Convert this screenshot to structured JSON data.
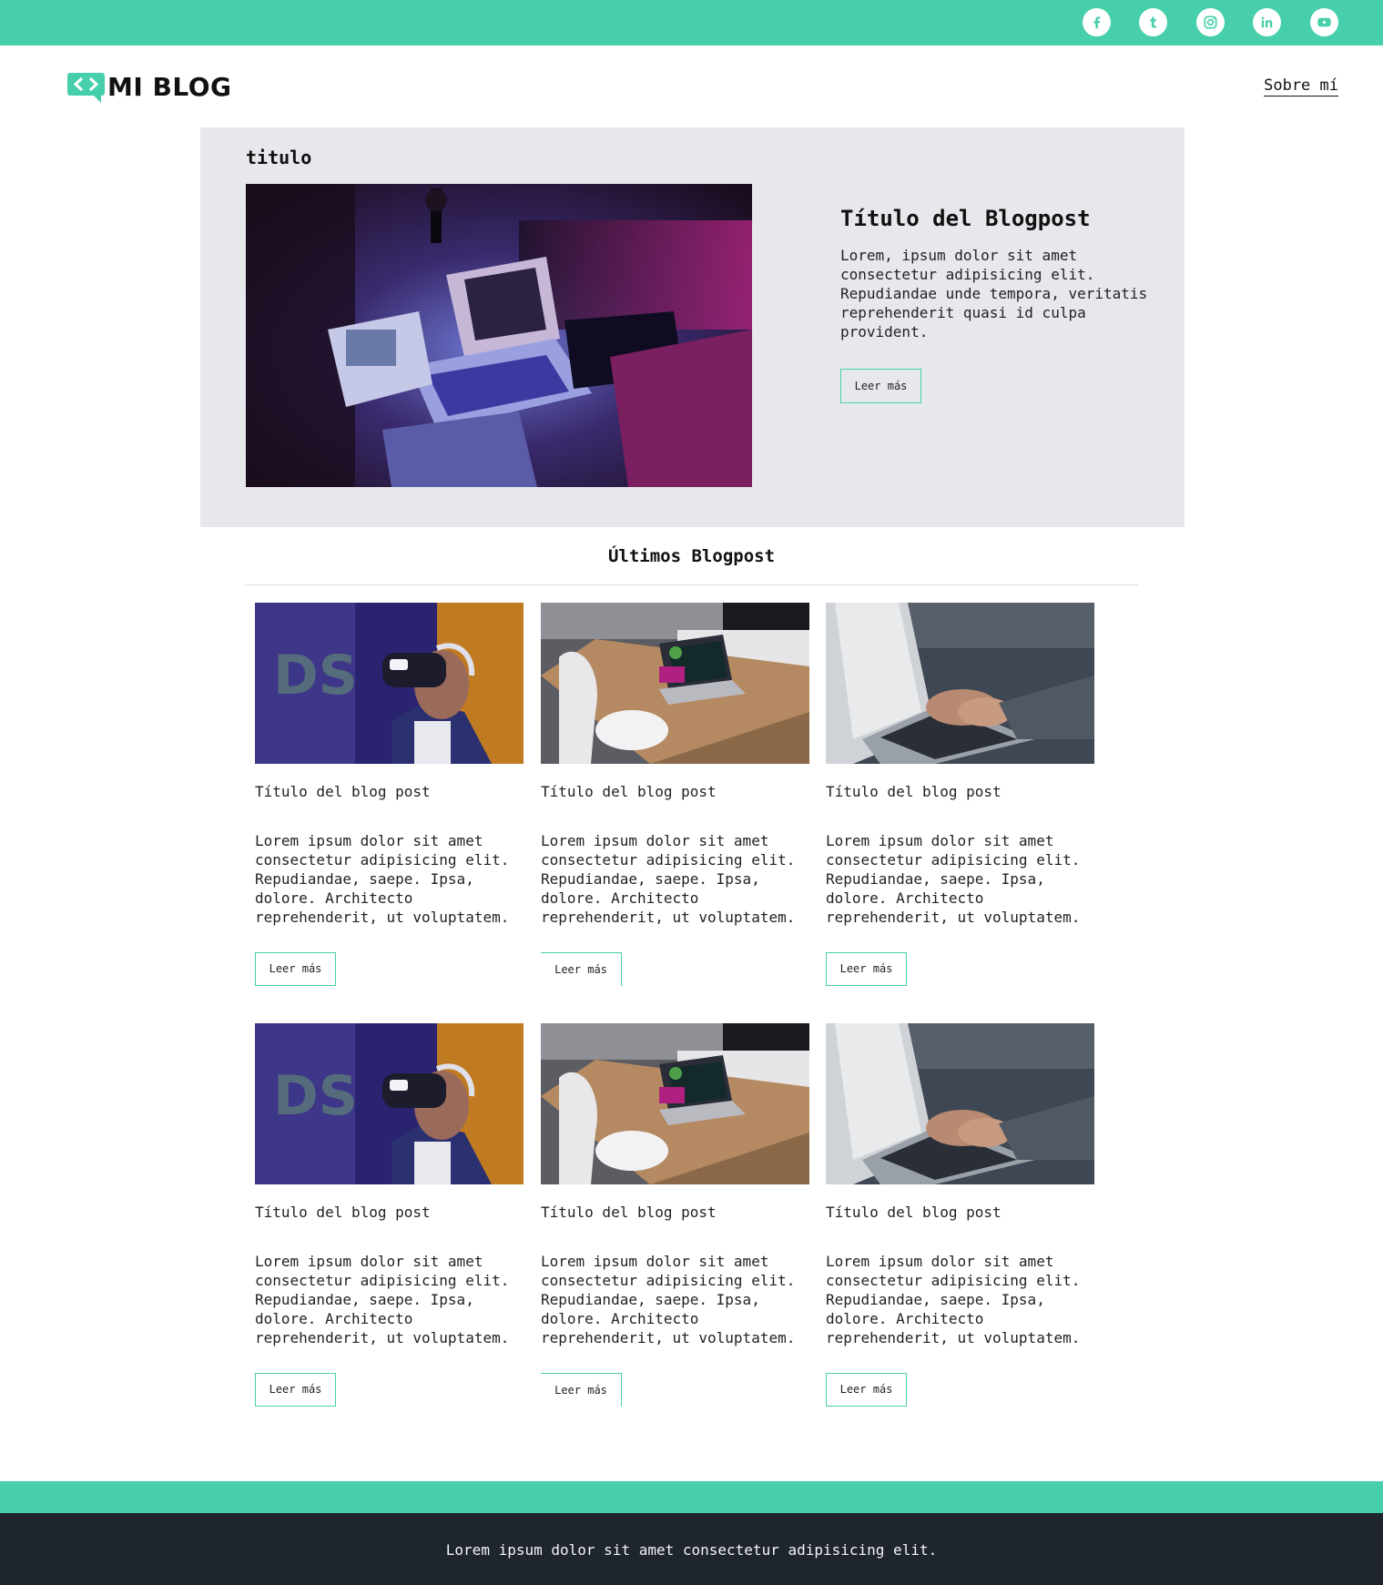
{
  "header": {
    "social": [
      {
        "name": "facebook-icon"
      },
      {
        "name": "tumblr-icon"
      },
      {
        "name": "instagram-icon"
      },
      {
        "name": "linkedin-icon"
      },
      {
        "name": "youtube-icon"
      }
    ],
    "logo_text": "MI BLOG",
    "about_link": "Sobre mí"
  },
  "hero": {
    "label": "titulo",
    "title": "Título del Blogpost",
    "description": "Lorem, ipsum dolor sit amet consectetur adipisicing elit. Repudiandae unde tempora, veritatis reprehenderit quasi id culpa provident.",
    "button": "Leer más"
  },
  "latest": {
    "title": "Últimos Blogpost",
    "posts": [
      {
        "title": "Título del blog post",
        "description": "Lorem ipsum dolor sit amet consectetur adipisicing elit. Repudiandae, saepe. Ipsa, dolore. Architecto reprehenderit, ut voluptatem.",
        "button": "Leer más"
      },
      {
        "title": "Título del blog post",
        "description": "Lorem ipsum dolor sit amet consectetur adipisicing elit. Repudiandae, saepe. Ipsa, dolore. Architecto reprehenderit, ut voluptatem.",
        "button": "Leer más"
      },
      {
        "title": "Título del blog post",
        "description": "Lorem ipsum dolor sit amet consectetur adipisicing elit. Repudiandae, saepe. Ipsa, dolore. Architecto reprehenderit, ut voluptatem.",
        "button": "Leer más"
      },
      {
        "title": "Título del blog post",
        "description": "Lorem ipsum dolor sit amet consectetur adipisicing elit. Repudiandae, saepe. Ipsa, dolore. Architecto reprehenderit, ut voluptatem.",
        "button": "Leer más"
      },
      {
        "title": "Título del blog post",
        "description": "Lorem ipsum dolor sit amet consectetur adipisicing elit. Repudiandae, saepe. Ipsa, dolore. Architecto reprehenderit, ut voluptatem.",
        "button": "Leer más"
      },
      {
        "title": "Título del blog post",
        "description": "Lorem ipsum dolor sit amet consectetur adipisicing elit. Repudiandae, saepe. Ipsa, dolore. Architecto reprehenderit, ut voluptatem.",
        "button": "Leer más"
      }
    ]
  },
  "footer": {
    "text": "Lorem ipsum dolor sit amet consectetur adipisicing elit."
  },
  "colors": {
    "accent": "#46cfaa",
    "hero_bg": "#e6e8ec",
    "footer_bg": "#1f252d"
  }
}
